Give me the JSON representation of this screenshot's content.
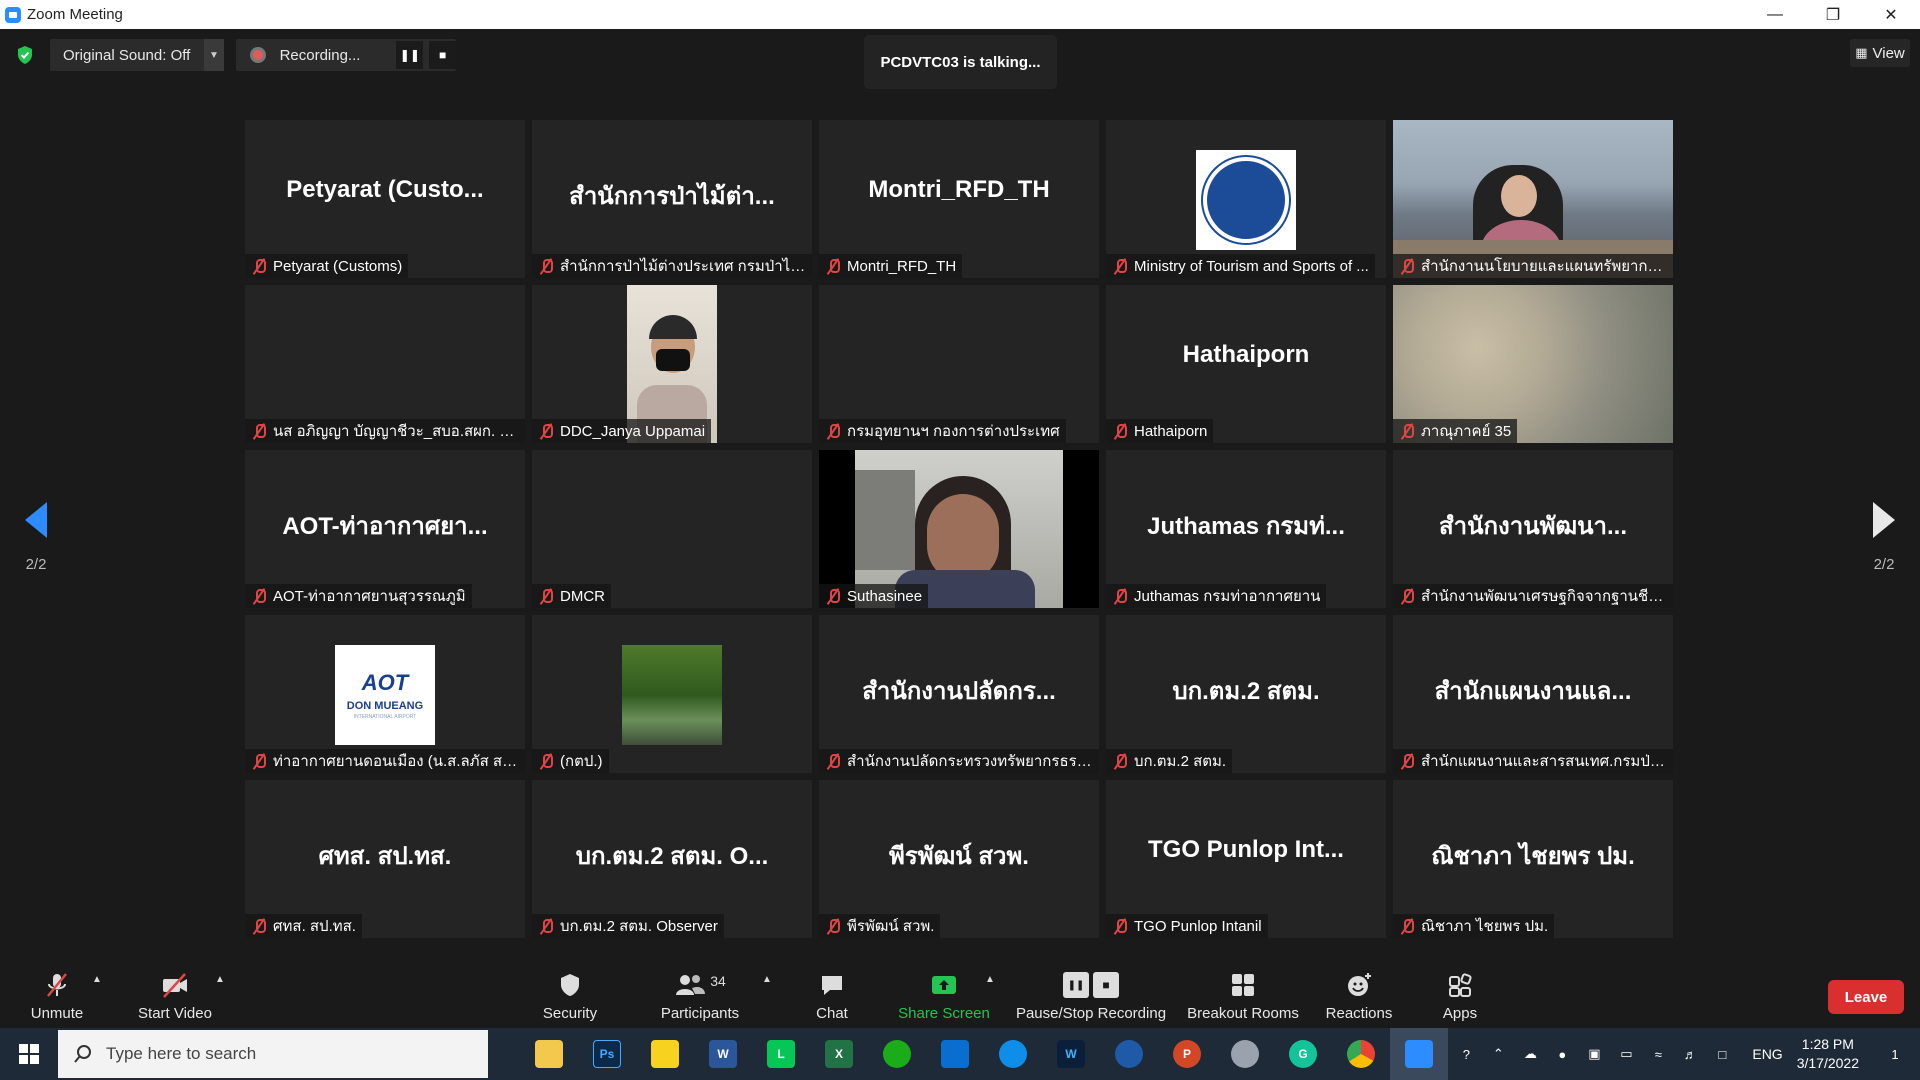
{
  "window": {
    "title": "Zoom Meeting"
  },
  "topbar": {
    "original_sound": "Original Sound: Off",
    "recording": "Recording...",
    "talking": "PCDVTC03 is talking...",
    "view": "View"
  },
  "pager": {
    "left": "2/2",
    "right": "2/2"
  },
  "tiles": [
    {
      "big": "Petyarat  (Custo...",
      "label": "Petyarat (Customs)",
      "kind": "text"
    },
    {
      "big": "สำนักการป่าไม้ต่า...",
      "label": "สำนักการป่าไม้ต่างประเทศ กรมป่าไม้ จุฑ...",
      "kind": "text"
    },
    {
      "big": "Montri_RFD_TH",
      "label": "Montri_RFD_TH",
      "kind": "text"
    },
    {
      "big": "",
      "label": "Ministry of Tourism and Sports of ...",
      "kind": "seal"
    },
    {
      "big": "",
      "label": "สำนักงานนโยบายและแผนทรัพยากรธรร...",
      "kind": "office"
    },
    {
      "big": "",
      "label": "นส อภิญญา บัญญาชีวะ_สบอ.สผก. ศุล...",
      "kind": "blank"
    },
    {
      "big": "",
      "label": "DDC_Janya Uppamai",
      "kind": "person"
    },
    {
      "big": "",
      "label": "กรมอุทยานฯ กองการต่างประเทศ",
      "kind": "blank"
    },
    {
      "big": "Hathaiporn",
      "label": "Hathaiporn",
      "kind": "text"
    },
    {
      "big": "",
      "label": "ภาณุภาคย์ 35",
      "kind": "blur"
    },
    {
      "big": "AOT-ท่าอากาศยา...",
      "label": "AOT-ท่าอากาศยานสุวรรณภูมิ",
      "kind": "text"
    },
    {
      "big": "",
      "label": "DMCR",
      "kind": "blank"
    },
    {
      "big": "",
      "label": "Suthasinee",
      "kind": "speaker"
    },
    {
      "big": "Juthamas กรมท่...",
      "label": "Juthamas กรมท่าอากาศยาน",
      "kind": "text"
    },
    {
      "big": "สำนักงานพัฒนา...",
      "label": "สำนักงานพัฒนาเศรษฐกิจจากฐานชีวภา...",
      "kind": "text"
    },
    {
      "big": "",
      "label": "ท่าอากาศยานดอนเมือง (น.ส.ลภัส  สรรพ...",
      "kind": "aot"
    },
    {
      "big": "",
      "label": "(กตป.)",
      "kind": "forest"
    },
    {
      "big": "สำนักงานปลัดกร...",
      "label": "สำนักงานปลัดกระทรวงทรัพยากรธรรมช...",
      "kind": "text"
    },
    {
      "big": "บก.ตม.2 สตม.",
      "label": "บก.ตม.2 สตม.",
      "kind": "text"
    },
    {
      "big": "สำนักแผนงานแล...",
      "label": "สำนักแผนงานและสารสนเทศ.กรมป่าไม้",
      "kind": "text"
    },
    {
      "big": "ศทส. สป.ทส.",
      "label": "ศทส. สป.ทส.",
      "kind": "text"
    },
    {
      "big": "บก.ตม.2 สตม. O...",
      "label": "บก.ตม.2 สตม. Observer",
      "kind": "text"
    },
    {
      "big": "พีรพัฒน์ สวพ.",
      "label": "พีรพัฒน์ สวพ.",
      "kind": "text"
    },
    {
      "big": "TGO Punlop Int...",
      "label": "TGO Punlop Intanil",
      "kind": "text"
    },
    {
      "big": "ณิชาภา ไชยพร ปม.",
      "label": "ณิชาภา ไชยพร ปม.",
      "kind": "text"
    }
  ],
  "aot_logo": {
    "line1": "AOT",
    "line2": "DON MUEANG",
    "line3": "INTERNATIONAL AIRPORT"
  },
  "toolbar": {
    "unmute": "Unmute",
    "start_video": "Start Video",
    "security": "Security",
    "participants": "Participants",
    "participants_count": "34",
    "chat": "Chat",
    "share_screen": "Share Screen",
    "pause_stop": "Pause/Stop Recording",
    "breakout": "Breakout Rooms",
    "reactions": "Reactions",
    "apps": "Apps",
    "leave": "Leave"
  },
  "taskbar": {
    "search_placeholder": "Type here to search",
    "lang": "ENG",
    "time": "1:28 PM",
    "date": "3/17/2022",
    "notif_count": "1"
  },
  "colors": {
    "accent": "#2d8cff",
    "leave": "#d9302f",
    "share": "#23c451",
    "muted": "#e04545"
  }
}
